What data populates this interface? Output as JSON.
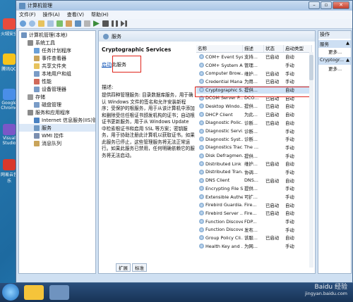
{
  "window": {
    "title": "计算机管理"
  },
  "desktop": {
    "icons": [
      {
        "label": "火绒安全",
        "color": "#e94b3c"
      },
      {
        "label": "腾讯QQ",
        "color": "#f7c31b"
      },
      {
        "label": "Google Chrome",
        "color": "#4a8ee8"
      },
      {
        "label": "Visual Studio",
        "color": "#7a57c7"
      },
      {
        "label": "网易云音乐",
        "color": "#d8382c"
      }
    ]
  },
  "menu": [
    "文件(F)",
    "操作(A)",
    "查看(V)",
    "帮助(H)"
  ],
  "tree": [
    {
      "label": "计算机管理(本地)",
      "indent": 0
    },
    {
      "label": "系统工具",
      "indent": 1
    },
    {
      "label": "任务计划程序",
      "indent": 2
    },
    {
      "label": "事件查看器",
      "indent": 2
    },
    {
      "label": "共享文件夹",
      "indent": 2
    },
    {
      "label": "本地用户和组",
      "indent": 2
    },
    {
      "label": "性能",
      "indent": 2
    },
    {
      "label": "设备管理器",
      "indent": 2
    },
    {
      "label": "存储",
      "indent": 1
    },
    {
      "label": "磁盘管理",
      "indent": 2
    },
    {
      "label": "服务和应用程序",
      "indent": 1
    },
    {
      "label": "Internet 信息服务(IIS)管",
      "indent": 2
    },
    {
      "label": "服务",
      "indent": 2,
      "selected": true
    },
    {
      "label": "WMI 控件",
      "indent": 2
    },
    {
      "label": "消息队列",
      "indent": 2
    }
  ],
  "mid": {
    "header": "服务",
    "service_name": "Cryptographic Services",
    "start_link": "启动",
    "start_suffix": "此服务",
    "desc_label": "描述:",
    "desc_text": "提供四种管理服务: 目录数据库服务，用于确认 Windows 文件的签名和允许安装新程序；受保护的根服务，用于从该计算机中添加和删除受信任根证书颁发机构的证书；自动根证书更新服务，用于从 Windows Update 中检索根证书和启用 SSL 等方案；密钥服务，用于协助注册此计算机以获取证书。如果此服务已停止，这些管理服务将无法正常运行。如果此服务已禁用，任何明确依赖它的服务将无法启动。",
    "columns": [
      "名称",
      "描述",
      "状态",
      "启动类型"
    ],
    "rows": [
      [
        "COM+ Event Sys...",
        "支持...",
        "已启动",
        "自动"
      ],
      [
        "COM+ System A...",
        "管理...",
        "",
        "手动"
      ],
      [
        "Computer Brow...",
        "维护...",
        "已启动",
        "手动"
      ],
      [
        "Credential Mana...",
        "为用...",
        "已启动",
        "手动"
      ],
      [
        "Cryptographic S...",
        "提供...",
        "",
        "自动"
      ],
      [
        "DCOM Server P...",
        "DCO...",
        "已启动",
        "自动"
      ],
      [
        "Desktop Windo...",
        "提供...",
        "已启动",
        "自动"
      ],
      [
        "DHCP Client",
        "为此...",
        "已启动",
        "自动"
      ],
      [
        "Diagnostic Polic...",
        "诊断...",
        "已启动",
        "自动"
      ],
      [
        "Diagnostic Servi...",
        "诊断...",
        "",
        "手动"
      ],
      [
        "Diagnostic Syst...",
        "诊断...",
        "",
        "手动"
      ],
      [
        "Diagnostics Trac...",
        "The ...",
        "",
        "手动"
      ],
      [
        "Disk Defragmen...",
        "提供...",
        "",
        "手动"
      ],
      [
        "Distributed Link ...",
        "维护...",
        "已启动",
        "自动"
      ],
      [
        "Distributed Tran...",
        "协调...",
        "",
        "手动"
      ],
      [
        "DNS Client",
        "DNS...",
        "已启动",
        "自动"
      ],
      [
        "Encrypting File S...",
        "提供...",
        "",
        "手动"
      ],
      [
        "Extensible Authe...",
        "可扩...",
        "",
        "手动"
      ],
      [
        "Firebird Guardia...",
        "Fire...",
        "已启动",
        "自动"
      ],
      [
        "Firebird Server ...",
        "Fire...",
        "已启动",
        "自动"
      ],
      [
        "Function Discove...",
        "FDP...",
        "",
        "手动"
      ],
      [
        "Function Discove...",
        "发布...",
        "",
        "手动"
      ],
      [
        "Group Policy Cli...",
        "该服...",
        "已启动",
        "自动"
      ],
      [
        "Health Key and ...",
        "为网...",
        "",
        "手动"
      ]
    ],
    "tabs": [
      "扩展",
      "标准"
    ]
  },
  "actions": {
    "header": "操作",
    "sections": [
      {
        "title": "服务",
        "more": "更多..."
      },
      {
        "title": "Cryptogr...",
        "more": "更多..."
      }
    ]
  },
  "watermark": {
    "brand": "Baidu 经验",
    "url": "jingyan.baidu.com"
  }
}
